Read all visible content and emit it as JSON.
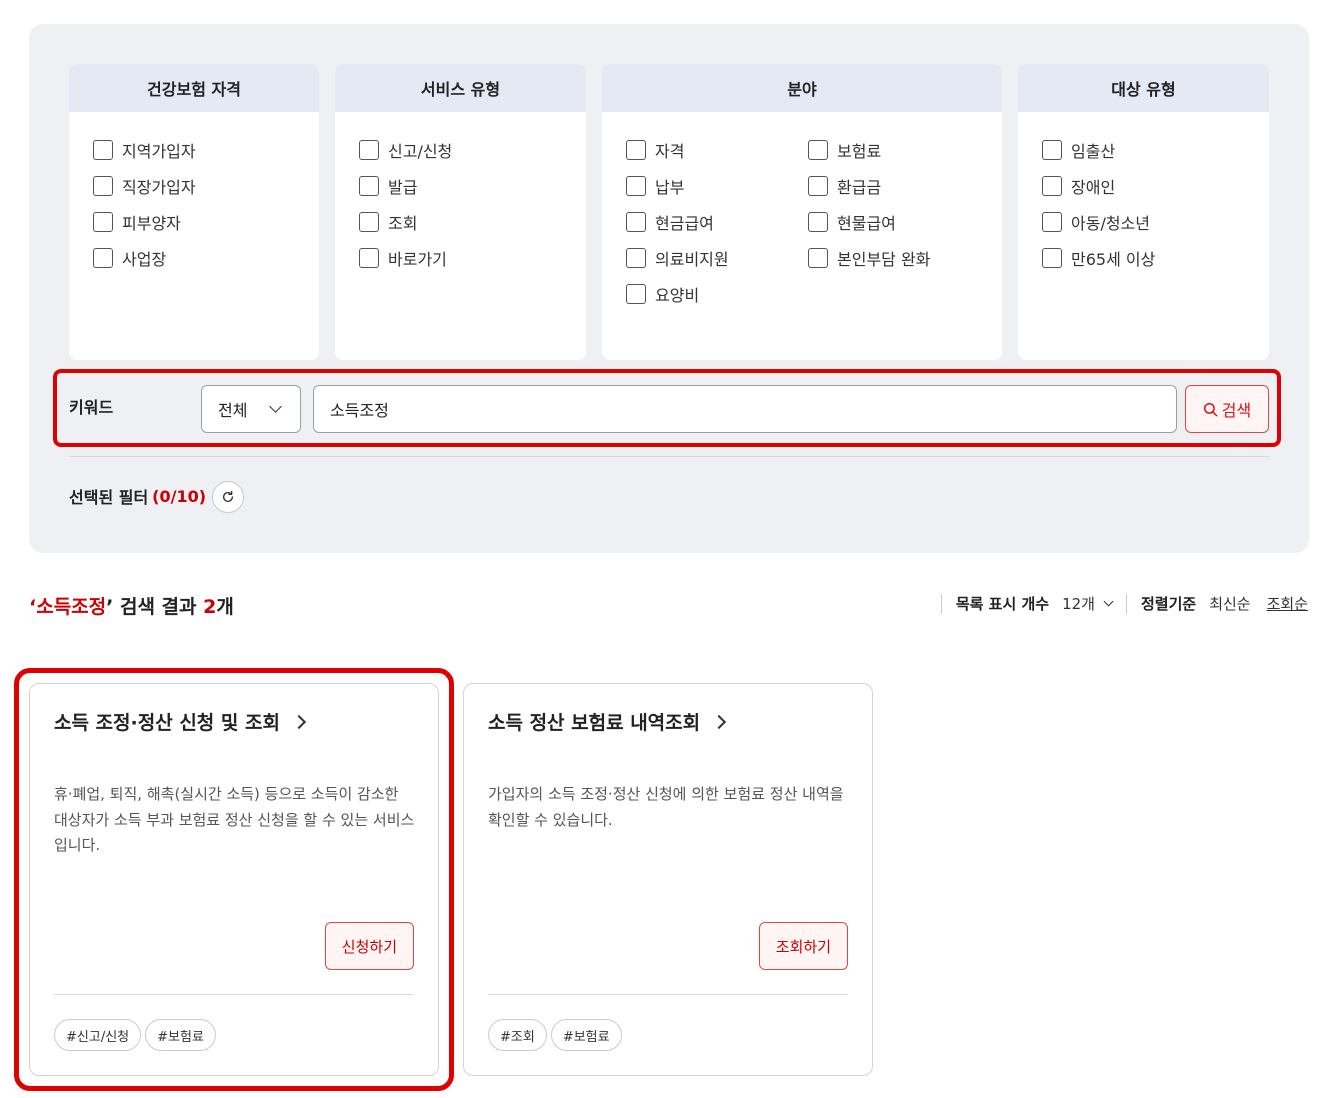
{
  "filters": {
    "insurance": {
      "title": "건강보험 자격",
      "options": [
        "지역가입자",
        "직장가입자",
        "피부양자",
        "사업장"
      ]
    },
    "service": {
      "title": "서비스 유형",
      "options": [
        "신고/신청",
        "발급",
        "조회",
        "바로가기"
      ]
    },
    "field": {
      "title": "분야",
      "options": [
        "자격",
        "보험료",
        "납부",
        "환급금",
        "현금급여",
        "현물급여",
        "의료비지원",
        "본인부담 완화",
        "요양비"
      ]
    },
    "target": {
      "title": "대상 유형",
      "options": [
        "임출산",
        "장애인",
        "아동/청소년",
        "만65세 이상"
      ]
    }
  },
  "keyword": {
    "label": "키워드",
    "scope": "전체",
    "value": "소득조정",
    "search_label": "검색"
  },
  "selected": {
    "label": "선택된 필터",
    "count": "(0/10)"
  },
  "result": {
    "open_quote": "‘",
    "keyword": "소득조정",
    "mid_text": "’ 검색 결과 ",
    "count": "2",
    "unit": "개"
  },
  "list_controls": {
    "count_label": "목록 표시 개수",
    "count_value": "12개",
    "sort_label": "정렬기준",
    "sort_options": [
      "최신순",
      "조회순"
    ]
  },
  "cards": [
    {
      "title": "소득 조정·정산 신청 및 조회",
      "desc": "휴·폐업, 퇴직, 해촉(실시간 소득) 등으로 소득이 감소한 대상자가 소득 부과 보험료 정산 신청을 할 수 있는 서비스입니다.",
      "button": "신청하기",
      "tags": [
        "#신고/신청",
        "#보험료"
      ]
    },
    {
      "title": "소득 정산 보험료 내역조회",
      "desc": "가입자의 소득 조정·정산 신청에 의한 보험료 정산 내역을 확인할 수 있습니다.",
      "button": "조회하기",
      "tags": [
        "#조회",
        "#보험료"
      ]
    }
  ],
  "colors": {
    "accent": "#e00000",
    "panel_bg": "#eef0f4",
    "header_bg": "#e4e9f3"
  }
}
